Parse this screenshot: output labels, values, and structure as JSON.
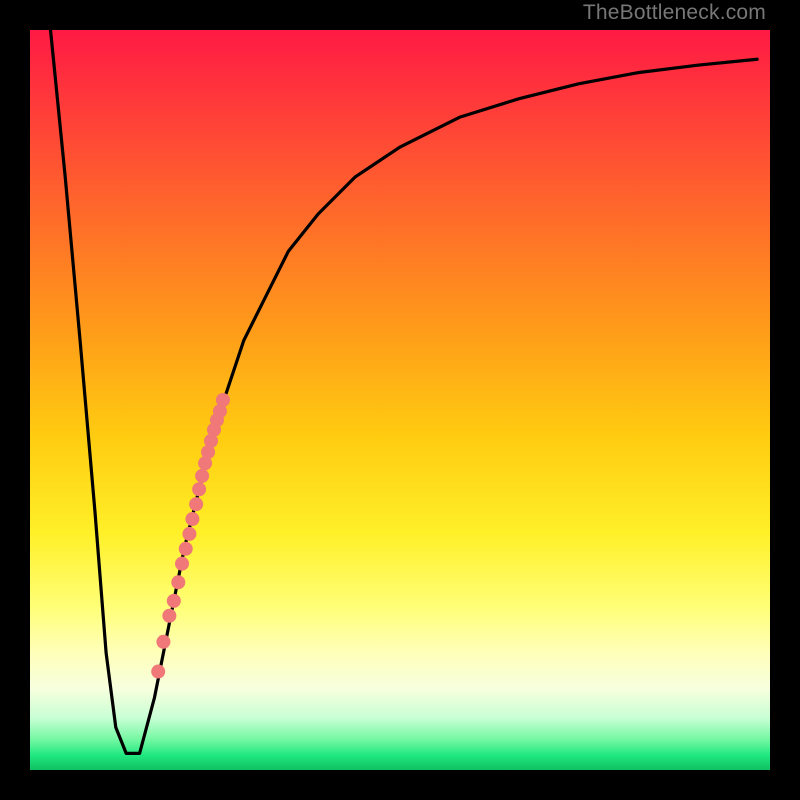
{
  "watermark": "TheBottleneck.com",
  "chart_data": {
    "type": "line",
    "title": "",
    "xlabel": "",
    "ylabel": "",
    "xlim": [
      0,
      100
    ],
    "ylim": [
      0,
      100
    ],
    "grid": false,
    "series": [
      {
        "name": "curve",
        "color": "#000000",
        "x": [
          3,
          5,
          7,
          9,
          10.5,
          11.8,
          13.2,
          15,
          17,
          19,
          21,
          23,
          25,
          27,
          29,
          32,
          35,
          39,
          44,
          50,
          58,
          66,
          74,
          82,
          90,
          98
        ],
        "y": [
          100,
          80,
          58,
          35,
          16,
          6,
          2.5,
          2.5,
          10,
          20,
          30,
          38,
          46,
          52,
          58,
          64,
          70,
          75,
          80,
          84,
          88,
          90.5,
          92.5,
          94,
          95,
          95.8
        ]
      }
    ],
    "markers": {
      "name": "highlighted-points",
      "color": "#f07878",
      "radius": 7,
      "x": [
        17.5,
        18.2,
        19.0,
        19.6,
        20.2,
        20.7,
        21.2,
        21.7,
        22.1,
        22.6,
        23.0,
        23.4,
        23.8,
        24.2,
        24.6,
        25.0,
        25.4,
        25.8,
        26.2
      ],
      "y": [
        13.5,
        17.5,
        21.0,
        23.0,
        25.5,
        28.0,
        30.0,
        32.0,
        34.0,
        36.0,
        38.0,
        39.8,
        41.5,
        43.0,
        44.5,
        46.0,
        47.3,
        48.5,
        50.0
      ]
    }
  }
}
